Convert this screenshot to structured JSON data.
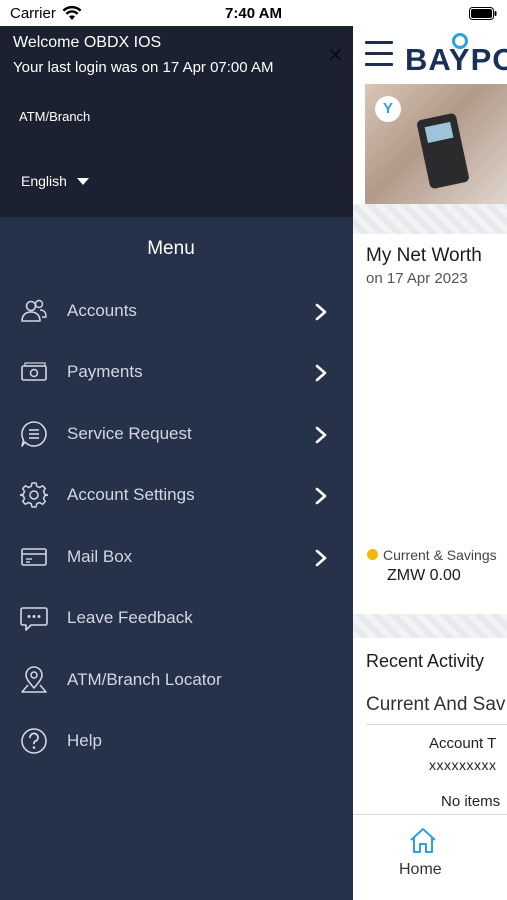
{
  "status_bar": {
    "carrier": "Carrier",
    "time": "7:40 AM"
  },
  "drawer": {
    "welcome": "Welcome OBDX IOS",
    "last_login": "Your last login was on 17 Apr 07:00 AM",
    "atm_branch": "ATM/Branch",
    "language": "English",
    "menu_title": "Menu",
    "items": [
      {
        "label": "Accounts",
        "icon": "users-icon",
        "has_arrow": true
      },
      {
        "label": "Payments",
        "icon": "money-icon",
        "has_arrow": true
      },
      {
        "label": "Service Request",
        "icon": "chat-list-icon",
        "has_arrow": true
      },
      {
        "label": "Account Settings",
        "icon": "gear-icon",
        "has_arrow": true
      },
      {
        "label": "Mail Box",
        "icon": "mailbox-icon",
        "has_arrow": true
      },
      {
        "label": "Leave Feedback",
        "icon": "feedback-icon",
        "has_arrow": false
      },
      {
        "label": "ATM/Branch Locator",
        "icon": "map-pin-icon",
        "has_arrow": false
      },
      {
        "label": "Help",
        "icon": "help-icon",
        "has_arrow": false
      }
    ]
  },
  "app": {
    "brand": "BAYPO",
    "banner_badge": "Y",
    "net_worth_title": "My Net Worth",
    "net_worth_date": "on 17 Apr 2023",
    "legend_label": "Current & Savings",
    "legend_value": "ZMW 0.00",
    "recent_title": "Recent Activity",
    "recent_tab": "Current And Sav",
    "account_type": "Account T",
    "account_number": "xxxxxxxxx",
    "no_items": "No items",
    "tab_home": "Home"
  },
  "colors": {
    "drawer_bg": "#26314a",
    "drawer_header_bg": "#1b2130",
    "brand": "#17315b",
    "accent": "#2aa0e6",
    "legend_dot": "#f5b800"
  }
}
